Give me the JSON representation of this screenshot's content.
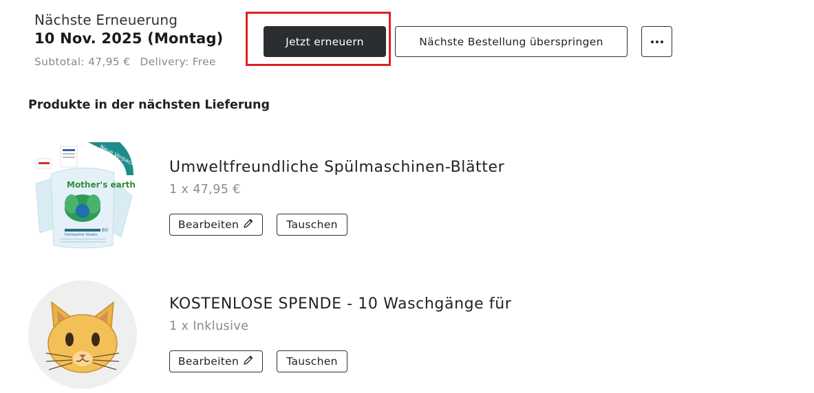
{
  "renewal": {
    "label": "Nächste Erneuerung",
    "date": "10 Nov. 2025 (Montag)",
    "subtotal": "Subtotal: 47,95 €",
    "delivery": "Delivery: Free"
  },
  "actions": {
    "renew_label": "Jetzt erneuern",
    "skip_label": "Nächste Bestellung überspringen",
    "more_icon": "ellipsis-icon"
  },
  "colors": {
    "primary_button": "#2b2e31",
    "highlight_border": "#e01f26"
  },
  "section_title": "Produkte in der nächsten Lieferung",
  "products": [
    {
      "name": "Umweltfreundliche Spülmaschinen-Blätter",
      "qty": "1 x 47,95 €",
      "edit_label": "Bearbeiten",
      "swap_label": "Tauschen",
      "image": {
        "brand": "Mother's earth",
        "badge": "Neue Verpackung",
        "package_label": "Dishwasher Sheets",
        "count": "60"
      }
    },
    {
      "name": "KOSTENLOSE SPENDE - 10 Waschgänge für",
      "qty": "1 x Inklusive",
      "edit_label": "Bearbeiten",
      "swap_label": "Tauschen",
      "image": {
        "icon": "cat-face-icon"
      }
    }
  ]
}
